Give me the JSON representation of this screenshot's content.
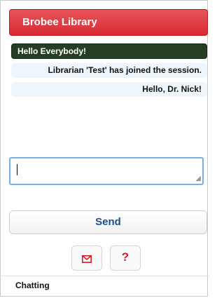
{
  "header": {
    "title": "Brobee Library"
  },
  "chat": {
    "messages": [
      {
        "text": "Hello Everybody!",
        "style": "highlight"
      },
      {
        "text": "Librarian 'Test' has joined the session.",
        "style": "normal"
      },
      {
        "text": "Hello, Dr. Nick!",
        "style": "normal"
      }
    ]
  },
  "composer": {
    "value": "",
    "send_label": "Send"
  },
  "toolbar": {
    "email_icon": "mail-icon",
    "help_icon": "help-icon",
    "help_glyph": "?"
  },
  "status": {
    "text": "Chatting"
  },
  "colors": {
    "header": "#d82b34",
    "highlight": "#253d24",
    "send_text": "#1f4f8a",
    "help": "#d61f2a"
  }
}
